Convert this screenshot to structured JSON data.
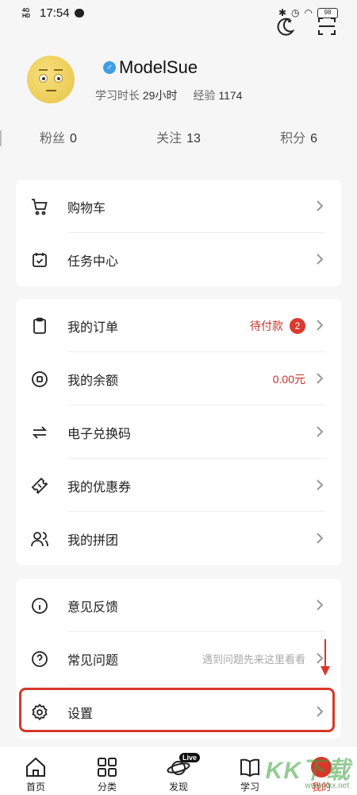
{
  "status_bar": {
    "network": "4G HD",
    "time": "17:54",
    "battery": "98"
  },
  "top_icons": [
    "moon-star-icon",
    "scan-icon"
  ],
  "profile": {
    "username": "ModelSue",
    "gender_symbol": "♂",
    "study_time_label": "学习时长",
    "study_time_value": "29小时",
    "experience_label": "经验",
    "experience_value": "1174"
  },
  "stats": [
    {
      "label": "粉丝",
      "value": "0"
    },
    {
      "label": "关注",
      "value": "13"
    },
    {
      "label": "积分",
      "value": "6"
    }
  ],
  "menu_groups": [
    {
      "items": [
        {
          "label": "购物车",
          "icon": "cart-icon"
        },
        {
          "label": "任务中心",
          "icon": "calendar-check-icon"
        }
      ]
    },
    {
      "items": [
        {
          "label": "我的订单",
          "icon": "clipboard-icon",
          "status": "待付款",
          "badge": "2"
        },
        {
          "label": "我的余额",
          "icon": "coin-icon",
          "value": "0.00元"
        },
        {
          "label": "电子兑换码",
          "icon": "exchange-icon"
        },
        {
          "label": "我的优惠券",
          "icon": "ticket-icon"
        },
        {
          "label": "我的拼团",
          "icon": "group-icon"
        }
      ]
    },
    {
      "items": [
        {
          "label": "意见反馈",
          "icon": "info-icon"
        },
        {
          "label": "常见问题",
          "icon": "question-icon",
          "hint": "遇到问题先来这里看看"
        },
        {
          "label": "设置",
          "icon": "gear-icon"
        }
      ]
    }
  ],
  "tabs": [
    {
      "label": "首页",
      "icon": "home-icon"
    },
    {
      "label": "分类",
      "icon": "grid-icon"
    },
    {
      "label": "发现",
      "icon": "planet-icon",
      "tag": "Live"
    },
    {
      "label": "学习",
      "icon": "book-icon"
    },
    {
      "label": "我的",
      "icon": "user-icon",
      "active": true
    }
  ],
  "watermark": {
    "text": "KK下载",
    "url": "www.kkx.net"
  },
  "colors": {
    "accent": "#d9362a",
    "badge": "#d93a2f",
    "status_text": "#c8332a",
    "card_bg": "#ffffff",
    "page_bg": "#f6f6f6"
  }
}
